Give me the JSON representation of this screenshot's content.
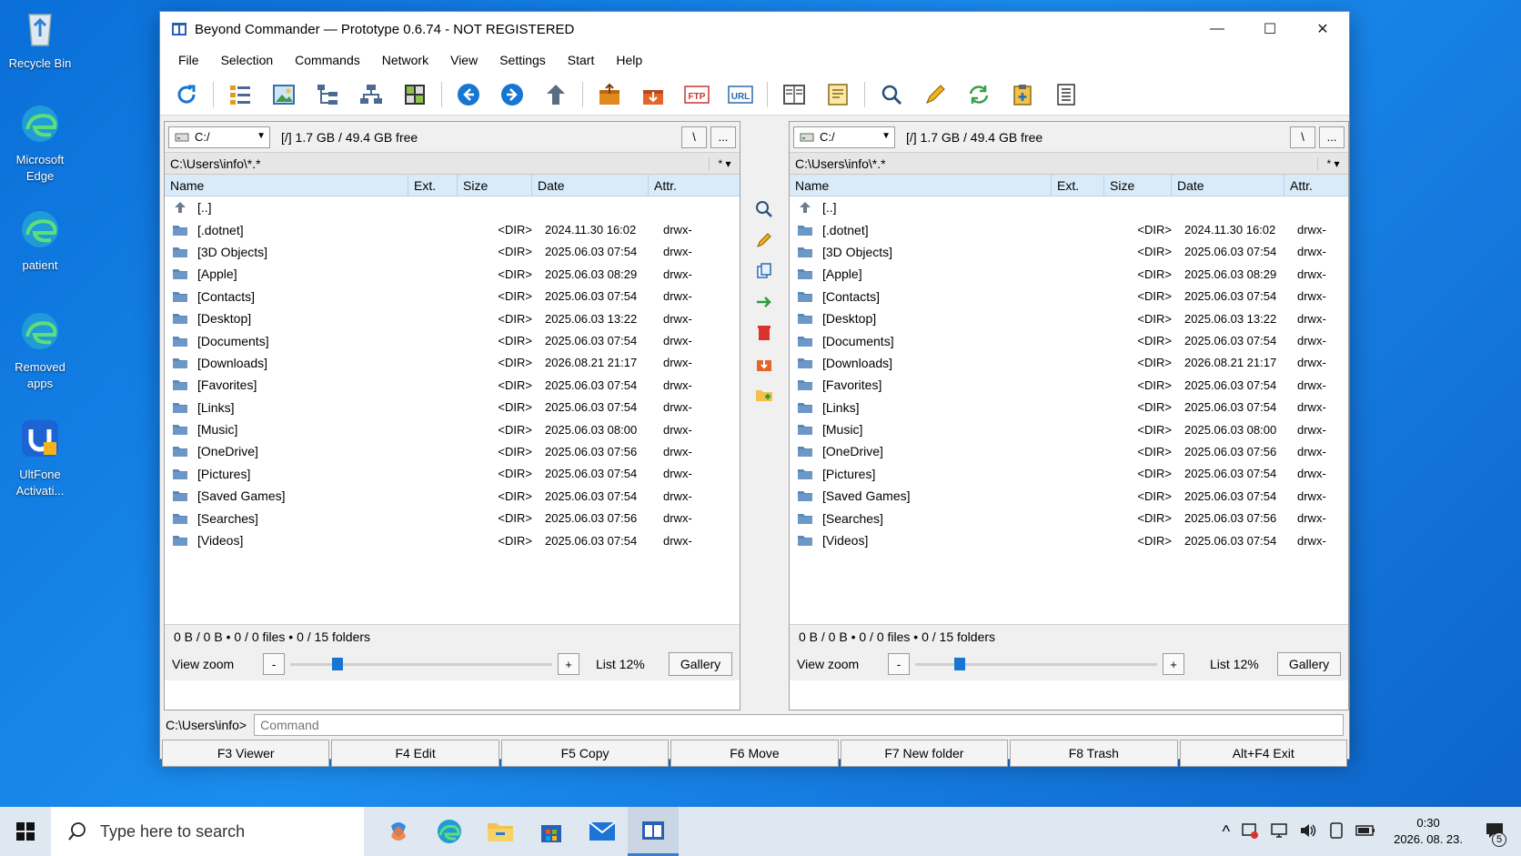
{
  "desktop": {
    "icons": [
      {
        "label": "Recycle Bin"
      },
      {
        "label": "Microsoft Edge"
      },
      {
        "label": "patient"
      },
      {
        "label": "Removed apps"
      },
      {
        "label": "UltFone Activati..."
      }
    ]
  },
  "window": {
    "title": "Beyond Commander — Prototype 0.6.74 - NOT REGISTERED",
    "controls": {
      "minimize": "—",
      "maximize": "☐",
      "close": "✕"
    }
  },
  "menu": [
    "File",
    "Selection",
    "Commands",
    "Network",
    "View",
    "Settings",
    "Start",
    "Help"
  ],
  "toolbar_icons": [
    "refresh-icon",
    "list-view-icon",
    "image-view-icon",
    "tree-view-icon",
    "network-tree-icon",
    "thumbnails-icon",
    "back-icon",
    "forward-icon",
    "up-icon",
    "pack-icon",
    "unpack-icon",
    "ftp-icon",
    "url-icon",
    "compare-panels-icon",
    "notes-icon",
    "search-icon",
    "edit-icon",
    "sync-icon",
    "clipboard-icon",
    "document-icon"
  ],
  "left_panel": {
    "drive": "C:/",
    "drive_info": "[/]  1.7 GB / 49.4 GB free",
    "root_btn": "\\",
    "more_btn": "...",
    "path": "C:\\Users\\info\\*.*",
    "filter": "* ▾",
    "columns": {
      "name": "Name",
      "ext": "Ext.",
      "size": "Size",
      "date": "Date",
      "attr": "Attr."
    },
    "status": "0 B / 0 B • 0 / 0 files • 0 / 15 folders",
    "zoom_label": "View zoom",
    "zoom_minus": "-",
    "zoom_plus": "+",
    "zoom_value": "List 12%",
    "zoom_fraction": 0.16,
    "gallery": "Gallery"
  },
  "right_panel": {
    "drive": "C:/",
    "drive_info": "[/]  1.7 GB / 49.4 GB free",
    "root_btn": "\\",
    "more_btn": "...",
    "path": "C:\\Users\\info\\*.*",
    "filter": "* ▾",
    "columns": {
      "name": "Name",
      "ext": "Ext.",
      "size": "Size",
      "date": "Date",
      "attr": "Attr."
    },
    "status": "0 B / 0 B • 0 / 0 files • 0 / 15 folders",
    "zoom_label": "View zoom",
    "zoom_minus": "-",
    "zoom_plus": "+",
    "zoom_value": "List 12%",
    "zoom_fraction": 0.16,
    "gallery": "Gallery"
  },
  "files": [
    {
      "name": "[..]",
      "size": "",
      "date": "",
      "attr": "",
      "up": true
    },
    {
      "name": "[.dotnet]",
      "size": "<DIR>",
      "date": "2024.11.30 16:02",
      "attr": "drwx-"
    },
    {
      "name": "[3D Objects]",
      "size": "<DIR>",
      "date": "2025.06.03 07:54",
      "attr": "drwx-"
    },
    {
      "name": "[Apple]",
      "size": "<DIR>",
      "date": "2025.06.03 08:29",
      "attr": "drwx-"
    },
    {
      "name": "[Contacts]",
      "size": "<DIR>",
      "date": "2025.06.03 07:54",
      "attr": "drwx-"
    },
    {
      "name": "[Desktop]",
      "size": "<DIR>",
      "date": "2025.06.03 13:22",
      "attr": "drwx-"
    },
    {
      "name": "[Documents]",
      "size": "<DIR>",
      "date": "2025.06.03 07:54",
      "attr": "drwx-"
    },
    {
      "name": "[Downloads]",
      "size": "<DIR>",
      "date": "2026.08.21 21:17",
      "attr": "drwx-"
    },
    {
      "name": "[Favorites]",
      "size": "<DIR>",
      "date": "2025.06.03 07:54",
      "attr": "drwx-"
    },
    {
      "name": "[Links]",
      "size": "<DIR>",
      "date": "2025.06.03 07:54",
      "attr": "drwx-"
    },
    {
      "name": "[Music]",
      "size": "<DIR>",
      "date": "2025.06.03 08:00",
      "attr": "drwx-"
    },
    {
      "name": "[OneDrive]",
      "size": "<DIR>",
      "date": "2025.06.03 07:56",
      "attr": "drwx-"
    },
    {
      "name": "[Pictures]",
      "size": "<DIR>",
      "date": "2025.06.03 07:54",
      "attr": "drwx-"
    },
    {
      "name": "[Saved Games]",
      "size": "<DIR>",
      "date": "2025.06.03 07:54",
      "attr": "drwx-"
    },
    {
      "name": "[Searches]",
      "size": "<DIR>",
      "date": "2025.06.03 07:56",
      "attr": "drwx-"
    },
    {
      "name": "[Videos]",
      "size": "<DIR>",
      "date": "2025.06.03 07:54",
      "attr": "drwx-"
    }
  ],
  "midstrip_icons": [
    "view-icon",
    "edit-icon",
    "copy-icon",
    "move-icon",
    "delete-icon",
    "unpack-icon",
    "new-folder-icon"
  ],
  "command": {
    "prompt": "C:\\Users\\info>",
    "placeholder": "Command"
  },
  "fkeys": [
    "F3 Viewer",
    "F4 Edit",
    "F5 Copy",
    "F6 Move",
    "F7 New folder",
    "F8 Trash",
    "Alt+F4 Exit"
  ],
  "taskbar": {
    "search_placeholder": "Type here to search",
    "time": "0:30",
    "date": "2026. 08. 23.",
    "notification_count": "5"
  },
  "colors": {
    "accent": "#1676d2",
    "header_bg": "#d9ebf9",
    "folder": "#5b87b8"
  }
}
